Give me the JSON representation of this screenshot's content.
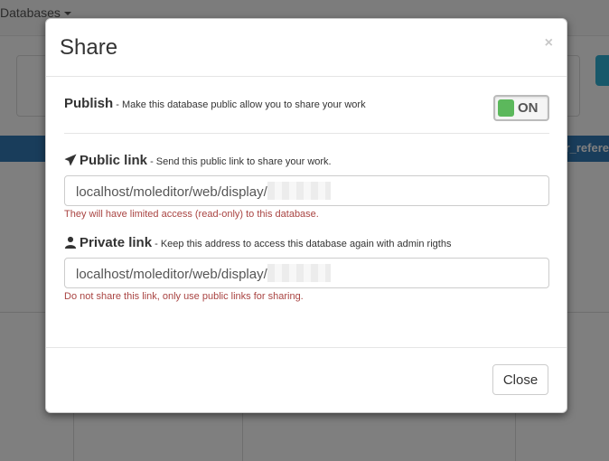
{
  "background": {
    "nav_item": "Databases",
    "bar_text": "r_refere"
  },
  "modal": {
    "title": "Share",
    "close_icon_char": "×",
    "publish": {
      "title": "Publish",
      "help": " - Make this database public allow you to share your work",
      "toggle_label": "ON",
      "toggle_state": "on",
      "toggle_color": "#5cb85c"
    },
    "public_link": {
      "title": "Public link",
      "help": " - Send this public link to share your work.",
      "value": "localhost/moleditor/web/display/",
      "note": "They will have limited access (read-only) to this database.",
      "icon": "send-icon"
    },
    "private_link": {
      "title": "Private link",
      "help": " - Keep this address to access this database again with admin rigths",
      "value": "localhost/moleditor/web/display/",
      "note": "Do not share this link, only use public links for sharing.",
      "icon": "user-icon"
    },
    "close_button_label": "Close"
  },
  "colors": {
    "error_text": "#a94442",
    "accent_blue": "#337ab7"
  }
}
